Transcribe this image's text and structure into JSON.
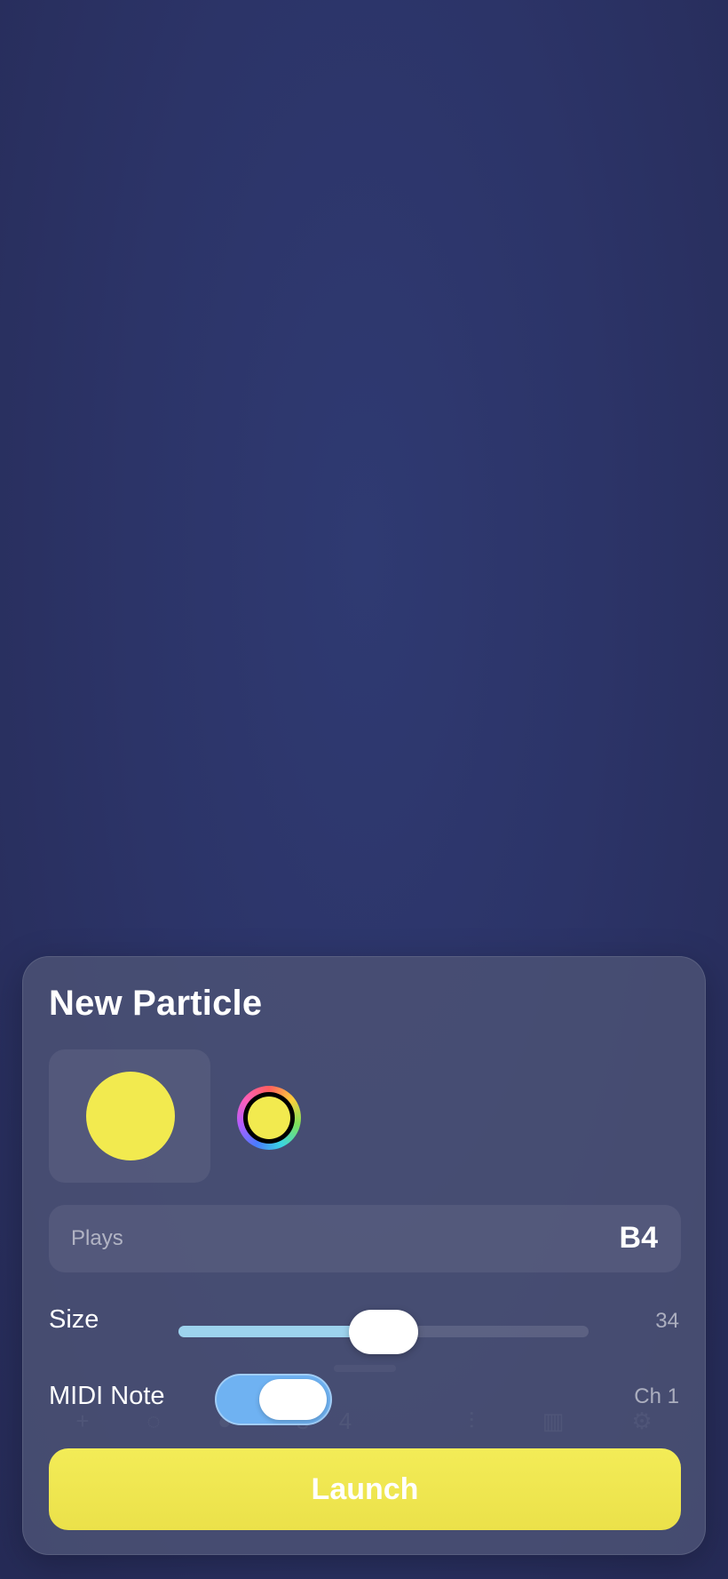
{
  "colors": {
    "particle": "#f2ea4f",
    "accent_toggle": "#6fb2f2",
    "slider_fill": "#9dd3ee",
    "launch": "#f0e751"
  },
  "background_toolbar": {
    "items": [
      {
        "icon": "plus-icon",
        "glyph": "+"
      },
      {
        "icon": "dashed-circle-icon",
        "glyph": "◌"
      },
      {
        "icon": "filled-circle-icon",
        "glyph": "●"
      },
      {
        "icon": "number-icon",
        "glyph": "3"
      },
      {
        "icon": "number-icon",
        "glyph": "4"
      },
      {
        "icon": "sliders-icon",
        "glyph": "⫶"
      },
      {
        "icon": "piano-icon",
        "glyph": "▥"
      },
      {
        "icon": "gear-icon",
        "glyph": "⚙"
      }
    ]
  },
  "panel": {
    "title": "New Particle",
    "preview_icon": "particle-circle-icon",
    "color_picker_icon": "color-wheel-icon",
    "plays": {
      "label": "Plays",
      "value": "B4"
    },
    "size": {
      "label": "Size",
      "value": "34",
      "slider_fraction": 0.5
    },
    "midi": {
      "label": "MIDI Note",
      "enabled": true,
      "channel": "Ch 1"
    },
    "launch_label": "Launch"
  }
}
